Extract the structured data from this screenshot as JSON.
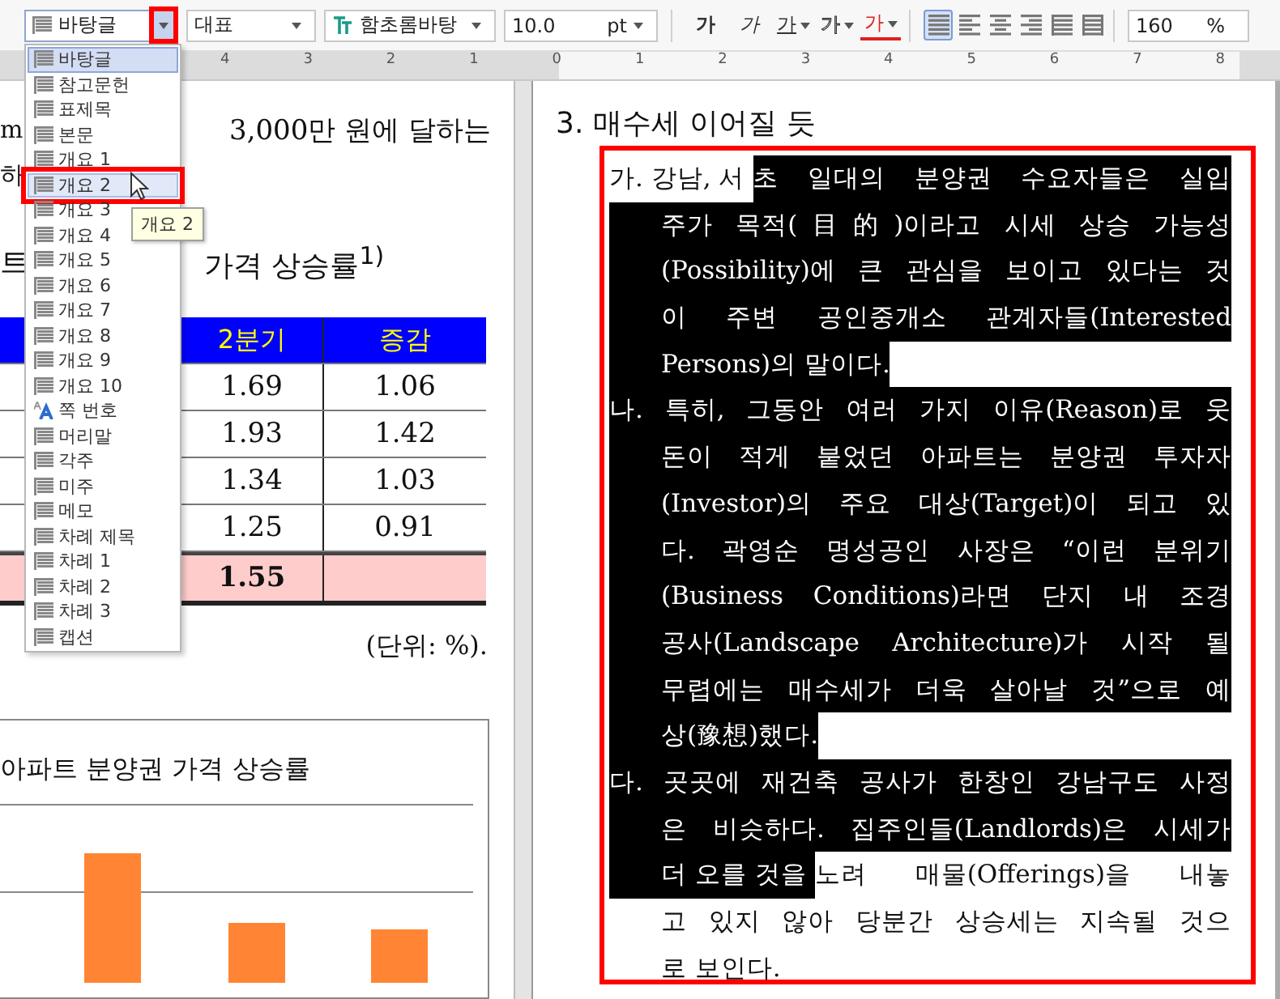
{
  "toolbar": {
    "style_box": {
      "value": "바탕글",
      "open": true,
      "highlighted": true
    },
    "representative_box": {
      "value": "대표"
    },
    "font_box": {
      "value": "함초롬바탕"
    },
    "size_box": {
      "value": "10.0",
      "unit": "pt"
    },
    "format_buttons": [
      {
        "label": "가",
        "kind": "bold"
      },
      {
        "label": "가",
        "kind": "italic"
      },
      {
        "label": "가",
        "kind": "underline"
      },
      {
        "label": "가",
        "kind": "outline"
      },
      {
        "label": "가",
        "kind": "color"
      }
    ],
    "align_buttons": [
      {
        "kind": "justify",
        "selected": true
      },
      {
        "kind": "left",
        "selected": false
      },
      {
        "kind": "center",
        "selected": false
      },
      {
        "kind": "right",
        "selected": false
      },
      {
        "kind": "distribute",
        "selected": false
      },
      {
        "kind": "divide",
        "selected": false
      }
    ],
    "zoom_box": {
      "value": "160",
      "unit": "%"
    }
  },
  "ruler": {
    "labels": [
      "4",
      "3",
      "2",
      "1",
      "0",
      "1",
      "2",
      "3",
      "4",
      "5",
      "6",
      "7",
      "8"
    ]
  },
  "style_menu": {
    "items": [
      {
        "label": "바탕글",
        "kind": "paragraph",
        "selected": true,
        "hovered": false
      },
      {
        "label": "참고문헌",
        "kind": "paragraph",
        "selected": false,
        "hovered": false
      },
      {
        "label": "표제목",
        "kind": "paragraph",
        "selected": false,
        "hovered": false
      },
      {
        "label": "본문",
        "kind": "paragraph",
        "selected": false,
        "hovered": false
      },
      {
        "label": "개요 1",
        "kind": "paragraph",
        "selected": false,
        "hovered": false
      },
      {
        "label": "개요 2",
        "kind": "paragraph",
        "selected": false,
        "hovered": true
      },
      {
        "label": "개요 3",
        "kind": "paragraph",
        "selected": false,
        "hovered": false
      },
      {
        "label": "개요 4",
        "kind": "paragraph",
        "selected": false,
        "hovered": false
      },
      {
        "label": "개요 5",
        "kind": "paragraph",
        "selected": false,
        "hovered": false
      },
      {
        "label": "개요 6",
        "kind": "paragraph",
        "selected": false,
        "hovered": false
      },
      {
        "label": "개요 7",
        "kind": "paragraph",
        "selected": false,
        "hovered": false
      },
      {
        "label": "개요 8",
        "kind": "paragraph",
        "selected": false,
        "hovered": false
      },
      {
        "label": "개요 9",
        "kind": "paragraph",
        "selected": false,
        "hovered": false
      },
      {
        "label": "개요 10",
        "kind": "paragraph",
        "selected": false,
        "hovered": false
      },
      {
        "label": "쪽 번호",
        "kind": "character",
        "selected": false,
        "hovered": false
      },
      {
        "label": "머리말",
        "kind": "paragraph",
        "selected": false,
        "hovered": false
      },
      {
        "label": "각주",
        "kind": "paragraph",
        "selected": false,
        "hovered": false
      },
      {
        "label": "미주",
        "kind": "paragraph",
        "selected": false,
        "hovered": false
      },
      {
        "label": "메모",
        "kind": "paragraph",
        "selected": false,
        "hovered": false
      },
      {
        "label": "차례 제목",
        "kind": "paragraph",
        "selected": false,
        "hovered": false
      },
      {
        "label": "차례 1",
        "kind": "paragraph",
        "selected": false,
        "hovered": false
      },
      {
        "label": "차례 2",
        "kind": "paragraph",
        "selected": false,
        "hovered": false
      },
      {
        "label": "차례 3",
        "kind": "paragraph",
        "selected": false,
        "hovered": false
      },
      {
        "label": "캡션",
        "kind": "paragraph",
        "selected": false,
        "hovered": false
      }
    ],
    "tooltip": "개요 2"
  },
  "left_page": {
    "lines": [
      {
        "left": "m",
        "right": "3,000만 원에 달하는"
      },
      {
        "left": "하"
      }
    ],
    "table_title": {
      "left": "트",
      "right": "가격 상승률$^{1)}$"
    },
    "table": {
      "columns": [
        "2분기",
        "증감"
      ],
      "rows": [
        {
          "cells": [
            "1.69",
            "1.06"
          ],
          "total": false
        },
        {
          "cells": [
            "1.93",
            "1.42"
          ],
          "total": false
        },
        {
          "cells": [
            "1.34",
            "1.03"
          ],
          "total": false
        },
        {
          "cells": [
            "1.25",
            "0.91"
          ],
          "total": false
        },
        {
          "cells": [
            "1.55"
          ],
          "total": true
        }
      ]
    },
    "unit_note": "(단위: %).",
    "chart": {
      "title": "아파트 분양권 가격 상승률"
    }
  },
  "right_page": {
    "heading": "3. 매수세 이어질 듯",
    "highlighted": true,
    "paragraphs": [
      {
        "lines": [
          {
            "segments": [
              {
                "text": "가. 강남, 서",
                "selected": false
              },
              {
                "text": "초 일대의 분양권 수요자들은 실입",
                "selected": true
              }
            ]
          },
          {
            "segments": [
              {
                "text": "주가 목적(目的)이라고 시세 상승 가능성",
                "selected": true
              }
            ]
          },
          {
            "segments": [
              {
                "text": "(Possibility)에 큰 관심을 보이고 있다는 것",
                "selected": true
              }
            ]
          },
          {
            "segments": [
              {
                "text": "이 주변 공인중개소 관계자들(Interested",
                "selected": true
              }
            ]
          },
          {
            "segments": [
              {
                "text": "Persons)의 말이다.",
                "selected": true
              }
            ]
          }
        ]
      },
      {
        "lines": [
          {
            "segments": [
              {
                "text": "나. 특히, 그동안 여러 가지 이유(Reason)로 웃",
                "selected": true
              }
            ]
          },
          {
            "segments": [
              {
                "text": "돈이 적게 붙었던 아파트는 분양권 투자자",
                "selected": true
              }
            ]
          },
          {
            "segments": [
              {
                "text": "(Investor)의 주요 대상(Target)이 되고 있",
                "selected": true
              }
            ]
          },
          {
            "segments": [
              {
                "text": "다. 곽영순 명성공인 사장은 “이런 분위기",
                "selected": true
              }
            ]
          },
          {
            "segments": [
              {
                "text": "(Business Conditions)라면 단지 내 조경",
                "selected": true
              }
            ]
          },
          {
            "segments": [
              {
                "text": "공사(Landscape Architecture)가 시작 될",
                "selected": true
              }
            ]
          },
          {
            "segments": [
              {
                "text": "무렵에는 매수세가 더욱 살아날 것”으로 예",
                "selected": true
              }
            ]
          },
          {
            "segments": [
              {
                "text": "상(豫想)했다.",
                "selected": true
              }
            ]
          }
        ]
      },
      {
        "lines": [
          {
            "segments": [
              {
                "text": "다. 곳곳에 재건축 공사가 한창인 강남구도 사정",
                "selected": true
              }
            ]
          },
          {
            "segments": [
              {
                "text": "은 비슷하다. 집주인들(Landlords)은 시세가",
                "selected": true
              }
            ]
          },
          {
            "segments": [
              {
                "text": "더 오를 것을",
                "selected": true
              },
              {
                "text": "노려 매물(Offerings)을 내놓",
                "selected": false
              }
            ]
          },
          {
            "segments": [
              {
                "text": "고 있지 않아 당분간 상승세는 지속될 것으",
                "selected": false
              }
            ]
          },
          {
            "segments": [
              {
                "text": "로 보인다.",
                "selected": false
              }
            ]
          }
        ]
      }
    ]
  }
}
